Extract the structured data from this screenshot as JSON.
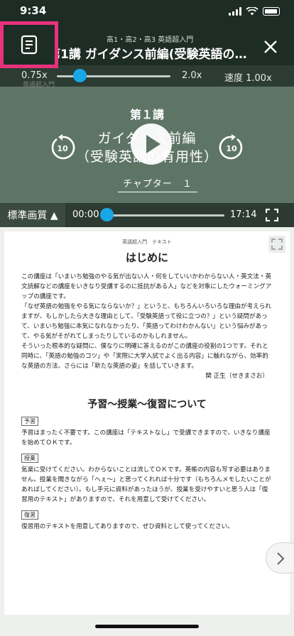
{
  "status": {
    "time": "9:34"
  },
  "header": {
    "subtitle": "高1・高2・高3 英語超入門",
    "title": "第1講 ガイダンス前編(受験英語の有…",
    "icons": {
      "text_toggle": "document-icon",
      "close": "close-icon"
    }
  },
  "player": {
    "speed_min": "0.75x",
    "speed_max": "2.0x",
    "speed_current": "速度 1.00x",
    "speed_value": 1.0,
    "ghost_label": "英語超入門",
    "lecture_no": "第１講",
    "lecture_title_1": "ガイダンス前編",
    "lecture_title_2": "（受験英語の有用性）",
    "rewind": "10",
    "forward": "10",
    "chapter": "チャプター　１",
    "quality": "標準画質 ▲",
    "time_now": "00:00",
    "time_total": "17:14",
    "progress": 0.0,
    "colors": {
      "accent": "#18a7e6",
      "highlight": "#e8327d"
    }
  },
  "document": {
    "head": "英語超入門　テキスト",
    "title": "はじめに",
    "intro": [
      "この講座は「いまいち勉強のやる気が出ない人・何をしていいかわからない人・英文法・英文読解などの講座をいきなり受講するのに抵抗がある人」などを対象にしたウォーミングアップの講座です。",
      "「なぜ英語の勉強をやる気にならないか？」というと、もちろんいろいろな理由が考えられますが、もしかしたら大きな理由として、「受験英語って役に立つの？」という疑問があって、いまいち勉強に本気になれなかったり、「英語ってわけわかんない」という悩みがあって、やる気がそがれてしまったりしているのかもしれません。",
      "そういった根本的な疑問に、僕なりに明確に答えるのがこの講座の役割の1つです。それと同時に、「英語の勉強のコツ」や「実際に大学入試でよく出る内容」に触れながら、効率的な英語の方法、さらには「新たな英語の姿」を話していきます。"
    ],
    "author": "関 正生（せきまさお）",
    "section_title": "予習～授業～復習について",
    "sections": [
      {
        "tag": "予習",
        "text": "予習はまったく不要です。この講座は「テキストなし」で受講できますので、いきなり講座を始めてＯＫです。"
      },
      {
        "tag": "授業",
        "text": "気楽に受けてください。わからないことは流してＯＫです。英帳の内容も写す必要はありません。授業を聞きながら「へぇ～」と思ってくれれば十分です（もちろんメモしたいことがあればしてください）。もし手元に資料があったほうが、授業を受けやすいと思う人は「復習用のテキスト」がありますので、それを用意して受けてください。"
      },
      {
        "tag": "復習",
        "text": "復習用のテキストを用意してありますので、ぜひ資料として使ってください。"
      }
    ]
  }
}
